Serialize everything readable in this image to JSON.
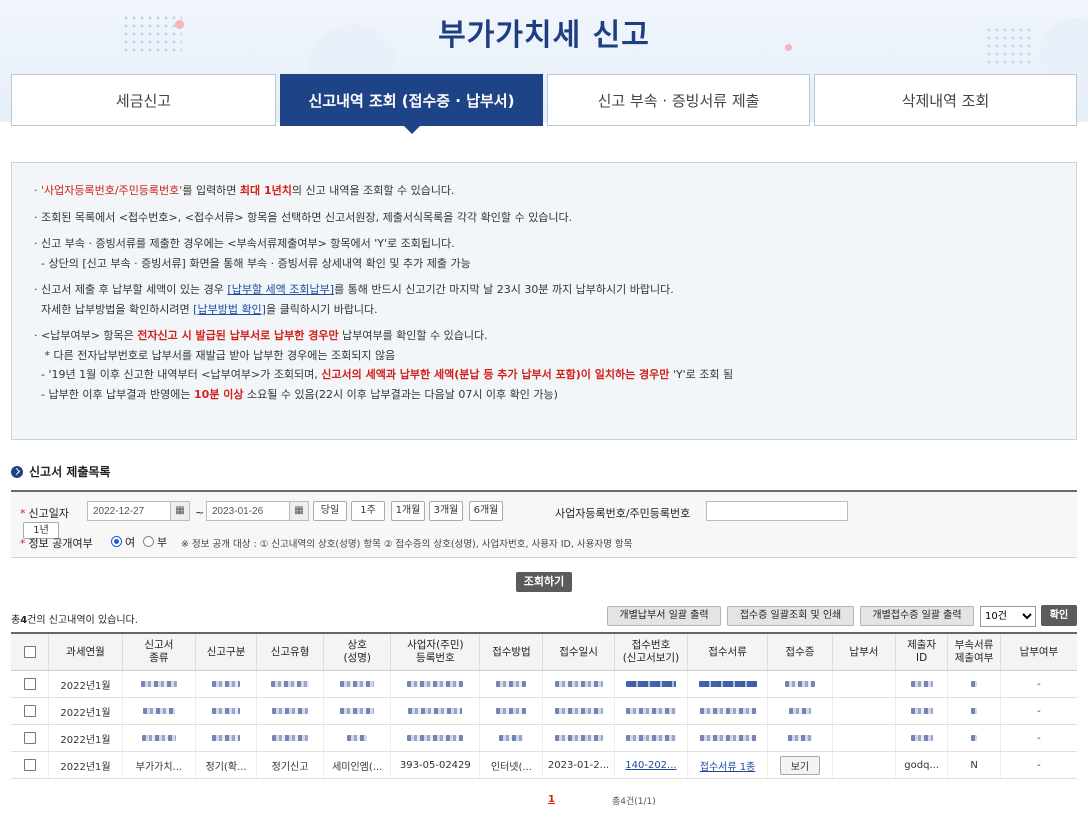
{
  "page": {
    "title": "부가가치세 신고"
  },
  "tabs": [
    {
      "label": "세금신고"
    },
    {
      "label": "신고내역 조회 (접수증 · 납부서)"
    },
    {
      "label": "신고 부속 · 증빙서류 제출"
    },
    {
      "label": "삭제내역 조회"
    }
  ],
  "notice": {
    "l1_a": "'사업자등록번호/주민등록번호'",
    "l1_b": "를 입력하면 ",
    "l1_c": "최대 1년치",
    "l1_d": "의 신고 내역을 조회할 수 있습니다.",
    "l2": "조회된 목록에서 <접수번호>, <접수서류> 항목을 선택하면 신고서원장, 제출서식목록을 각각 확인할 수 있습니다.",
    "l3": "신고 부속 · 증빙서류를 제출한 경우에는 <부속서류제출여부> 항목에서 'Y'로 조회됩니다.",
    "l3_sub": "- 상단의 [신고 부속 · 증빙서류] 화면을 통해 부속 · 증빙서류 상세내역 확인 및 추가 제출 가능",
    "l4_a": "신고서 제출 후 납부할 세액이 있는 경우 ",
    "l4_link": "[납부할 세액 조회납부]",
    "l4_b": "를 통해 반드시 신고기간 마지막 날 23시 30분 까지 납부하시기 바랍니다.",
    "l4_sub_a": "자세한 납부방법을 확인하시려면 ",
    "l4_sub_link": "[납부방법 확인]",
    "l4_sub_b": "을 클릭하시기 바랍니다.",
    "l5_a": "<납부여부> 항목은 ",
    "l5_b": "전자신고 시 발급된 납부서로 납부한 경우만",
    "l5_c": " 납부여부를 확인할 수 있습니다.",
    "l5_sub1": "* 다른 전자납부번호로 납부서를 재발급 받아 납부한 경우에는 조회되지 않음",
    "l5_sub2_a": "- '19년 1월 이후 신고한 내역부터 <납부여부>가 조회되며, ",
    "l5_sub2_b": "신고서의 세액과 납부한 세액(분납 등 추가 납부서 포함)이 일치하는 경우만",
    "l5_sub2_c": " 'Y'로 조회 됨",
    "l5_sub3_a": "- 납부한 이후 납부결과 반영에는 ",
    "l5_sub3_b": "10분 이상",
    "l5_sub3_c": " 소요될 수 있음(22시 이후 납부결과는 다음날 07시 이후 확인 가능)"
  },
  "section": {
    "title": "신고서 제출목록"
  },
  "filter": {
    "date_label": "신고일자",
    "date_from": "2022-12-27",
    "date_to": "2023-01-26",
    "tilde": "~",
    "periods": [
      "당일",
      "1주",
      "1개월",
      "3개월",
      "6개월",
      "1년"
    ],
    "biz_label": "사업자등록번호/주민등록번호",
    "biz_value": "",
    "disclosure_label": "정보 공개여부",
    "opt_yes": "여",
    "opt_no": "부",
    "disclosure_note": "※ 정보 공개 대상 : ① 신고내역의 상호(성명) 항목 ② 접수증의 상호(성명), 사업자번호, 사용자 ID, 사용자명 항목"
  },
  "search_button": "조회하기",
  "result": {
    "count_prefix": "총",
    "count_num": "4",
    "count_suffix": "건의 신고내역이 있습니다.",
    "btn_bulk_pay": "개별납부서 일괄 출력",
    "btn_bulk_receipt": "접수증 일괄조회 및 인쇄",
    "btn_bulk_indiv": "개별접수증 일괄 출력",
    "page_size": "10건",
    "btn_confirm": "확인"
  },
  "table": {
    "headers": [
      {
        "a": "과세연월",
        "b": ""
      },
      {
        "a": "신고서",
        "b": "종류"
      },
      {
        "a": "신고구분",
        "b": ""
      },
      {
        "a": "신고유형",
        "b": ""
      },
      {
        "a": "상호",
        "b": "(성명)"
      },
      {
        "a": "사업자(주민)",
        "b": "등록번호"
      },
      {
        "a": "접수방법",
        "b": ""
      },
      {
        "a": "접수일시",
        "b": ""
      },
      {
        "a": "접수번호",
        "b": "(신고서보기)"
      },
      {
        "a": "접수서류",
        "b": ""
      },
      {
        "a": "접수증",
        "b": ""
      },
      {
        "a": "납부서",
        "b": ""
      },
      {
        "a": "제출자",
        "b": "ID"
      },
      {
        "a": "부속서류",
        "b": "제출여부"
      },
      {
        "a": "납부여부",
        "b": ""
      }
    ],
    "rows": [
      {
        "period": "2022년1월",
        "paid": "-"
      },
      {
        "period": "2022년1월",
        "paid": "-"
      },
      {
        "period": "2022년1월",
        "paid": "-"
      },
      {
        "period": "2022년1월",
        "kind": "부가가치...",
        "div": "정기(확...",
        "type": "정기신고",
        "name": "세미인엠(...",
        "biz": "393-05-02429",
        "method": "인터넷(...",
        "time": "2023-01-2...",
        "rcpt": "140-202...",
        "docs": "접수서류 1종",
        "view": "보기",
        "submitter": "godq...",
        "attach": "N",
        "paid": "-"
      }
    ]
  },
  "pager": {
    "current": "1",
    "summary": "총4건(1/1)"
  },
  "colors": {
    "brand": "#1e4387",
    "red": "#d1211b"
  }
}
